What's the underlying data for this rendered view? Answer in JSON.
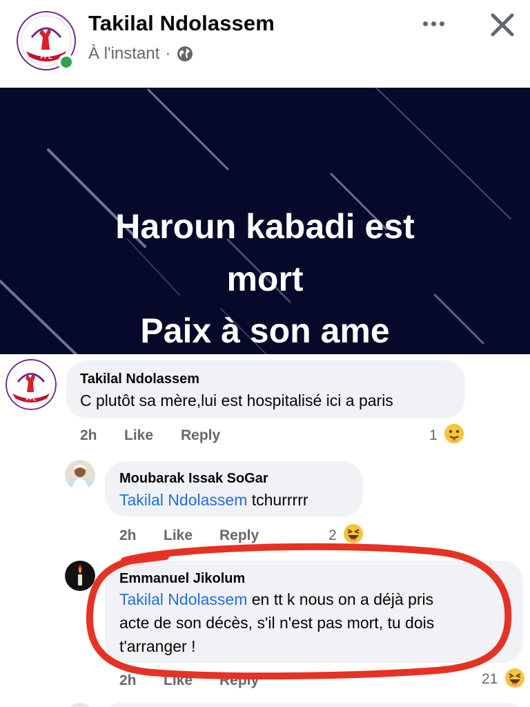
{
  "post": {
    "author": "Takilal Ndolassem",
    "timestamp": "À l'instant",
    "separator": "·",
    "privacy_icon": "globe-icon",
    "more_icon": "more-options-icon",
    "close_icon": "close-icon",
    "image_text": {
      "line1": "Haroun kabadi est",
      "line2": "mort",
      "line3": "Paix à son ame"
    }
  },
  "comments": [
    {
      "author": "Takilal Ndolassem",
      "text": "C plutôt sa mère,lui est hospitalisé ici a paris",
      "time": "2h",
      "like": "Like",
      "reply": "Reply",
      "reaction_count": "1",
      "reaction_icon": "care-emoji-icon"
    },
    {
      "author": "Moubarak Issak SoGar",
      "mention": "Takilal Ndolassem",
      "text": "tchurrrrr",
      "time": "2h",
      "like": "Like",
      "reply": "Reply",
      "reaction_count": "2",
      "reaction_icon": "haha-emoji-icon"
    },
    {
      "author": "Emmanuel Jikolum",
      "mention": "Takilal Ndolassem",
      "text_line1": "en tt k nous on a déjà pris",
      "text_line2": "acte de son décès, s'il n'est pas mort, tu dois",
      "text_line3": "t'arranger !",
      "time": "2h",
      "like": "Like",
      "reply": "Reply",
      "reaction_count": "21",
      "reaction_icon": "haha-emoji-icon"
    }
  ],
  "colors": {
    "mention": "#216fdb",
    "bubble": "#f0f2f5",
    "annotation": "#e53224",
    "online": "#31a24c",
    "image_bg": "#07092a"
  }
}
